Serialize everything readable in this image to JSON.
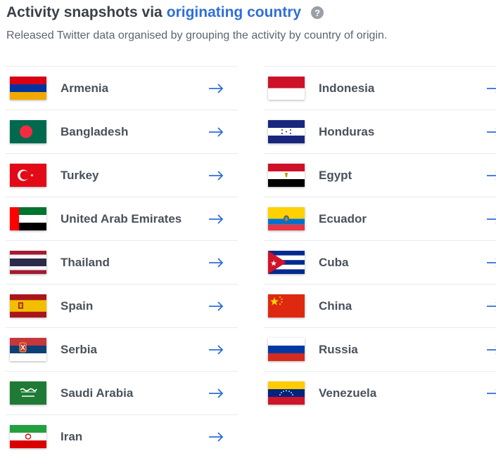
{
  "header": {
    "title_prefix": "Activity snapshots via",
    "title_link": "originating country",
    "help_symbol": "?",
    "subtitle": "Released Twitter data organised by grouping the activity by country of origin."
  },
  "colors": {
    "accent": "#2f6fd6",
    "arrow": "#2f6fd6"
  },
  "countries_left": [
    {
      "name": "Armenia",
      "flag": "armenia-flag"
    },
    {
      "name": "Bangladesh",
      "flag": "bangladesh-flag"
    },
    {
      "name": "Turkey",
      "flag": "turkey-flag"
    },
    {
      "name": "United Arab Emirates",
      "flag": "uae-flag"
    },
    {
      "name": "Thailand",
      "flag": "thailand-flag"
    },
    {
      "name": "Spain",
      "flag": "spain-flag"
    },
    {
      "name": "Serbia",
      "flag": "serbia-flag"
    },
    {
      "name": "Saudi Arabia",
      "flag": "saudi-arabia-flag"
    },
    {
      "name": "Iran",
      "flag": "iran-flag"
    }
  ],
  "countries_right": [
    {
      "name": "Indonesia",
      "flag": "indonesia-flag"
    },
    {
      "name": "Honduras",
      "flag": "honduras-flag"
    },
    {
      "name": "Egypt",
      "flag": "egypt-flag"
    },
    {
      "name": "Ecuador",
      "flag": "ecuador-flag"
    },
    {
      "name": "Cuba",
      "flag": "cuba-flag"
    },
    {
      "name": "China",
      "flag": "china-flag"
    },
    {
      "name": "Russia",
      "flag": "russia-flag"
    },
    {
      "name": "Venezuela",
      "flag": "venezuela-flag"
    }
  ],
  "arrow_icon": "arrow-right-icon"
}
